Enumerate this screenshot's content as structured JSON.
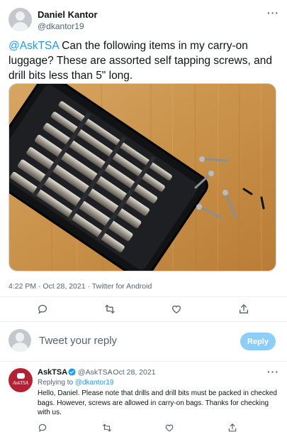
{
  "main_tweet": {
    "author_name": "Daniel Kantor",
    "author_handle": "@dkantor19",
    "more_label": "···",
    "mention": "@AskTSA",
    "text": " Can the following items in my carry-on luggage?  These are assorted self tapping screws, and drill bits less than 5\" long.",
    "timestamp": "4:22 PM · Oct 28, 2021 · Twitter for Android"
  },
  "photo": {
    "description_icon": "photo-of-drill-bit-case-and-screws"
  },
  "actions": {
    "icons": [
      "reply-icon",
      "retweet-icon",
      "like-icon",
      "share-icon"
    ]
  },
  "compose": {
    "placeholder": "Tweet your reply",
    "reply_label": "Reply"
  },
  "reply_tweet": {
    "author_name": "AskTSA",
    "author_handle": "@AskTSA",
    "date": "· Oct 28, 2021",
    "more_label": "···",
    "replying_prefix": "Replying to ",
    "replying_handle": "@dkantor19",
    "text": "Hello, Daniel. Please note that drills and drill bits must be packed in checked bags. However, screws are allowed in carry-on bags. Thanks for checking with us.",
    "avatar_text": "AskTSA"
  },
  "colors": {
    "accent": "#1d9bf0",
    "reply_button": "#8ecdf7",
    "tsa_red": "#b22234"
  }
}
